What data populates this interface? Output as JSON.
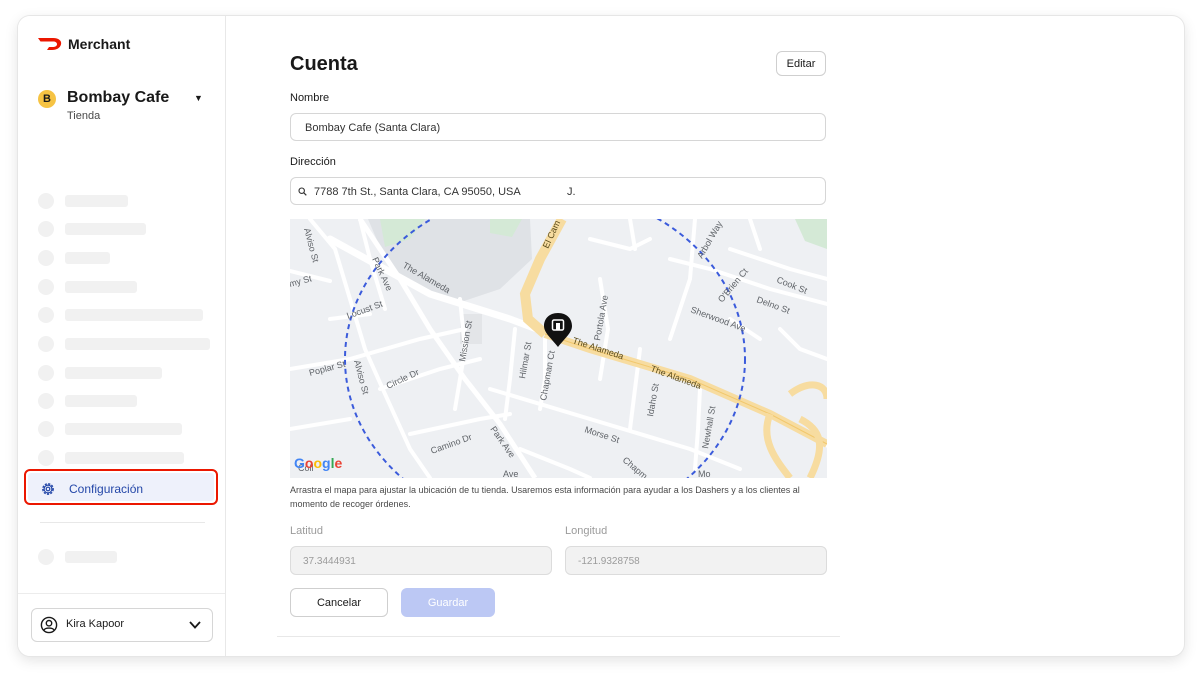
{
  "brand": {
    "name": "Merchant",
    "accent": "#eb1700"
  },
  "store": {
    "badge": "B",
    "name": "Bombay Cafe",
    "type": "Tienda"
  },
  "sidebar": {
    "active_item": {
      "label": "Configuración",
      "icon": "gear-icon"
    },
    "user": {
      "name": "Kira Kapoor",
      "icon": "user-circle-icon"
    }
  },
  "account": {
    "title": "Cuenta",
    "edit_label": "Editar",
    "name_label": "Nombre",
    "name_value": "Bombay Cafe (Santa Clara)",
    "address_label": "Dirección",
    "address_value": "7788 7th St., Santa Clara, CA 95050, USA",
    "address_suffix": "J.",
    "map_note": "Arrastra el mapa para ajustar la ubicación de tu tienda. Usaremos esta información para ayudar a los Dashers y a los clientes al momento de recoger órdenes.",
    "latitude_label": "Latitud",
    "latitude_value": "37.3444931",
    "longitude_label": "Longitud",
    "longitude_value": "-121.9328758",
    "cancel_label": "Cancelar",
    "save_label": "Guardar"
  },
  "map": {
    "provider": "Google",
    "streets": {
      "the_alameda_1": "The Alameda",
      "the_alameda_2": "The Alameda",
      "the_alameda_3": "The Alameda",
      "park_ave_1": "Park Ave",
      "park_ave_2": "Park Ave",
      "alviso_1": "Alviso St",
      "alviso_2": "Alviso St",
      "locust": "Locust St",
      "poplar": "Poplar St",
      "circle": "Circle Dr",
      "camino": "Camino Dr",
      "mission": "Mission St",
      "hilmar": "Hilmar St",
      "chapman": "Chapman Ct",
      "portola": "Portola Ave",
      "idaho": "Idaho St",
      "newhall": "Newhall St",
      "morse": "Morse St",
      "sherwood": "Sherwood Ave",
      "obrien": "O'Brien Ct",
      "delno": "Delno St",
      "cook": "Cook St",
      "arbol": "Arbol Way",
      "el_camino": "El Cam",
      "my_st": "my St",
      "coll": "Coll",
      "ave_bottom": "Ave",
      "chapm": "Chapm",
      "mo": "Mo"
    }
  }
}
